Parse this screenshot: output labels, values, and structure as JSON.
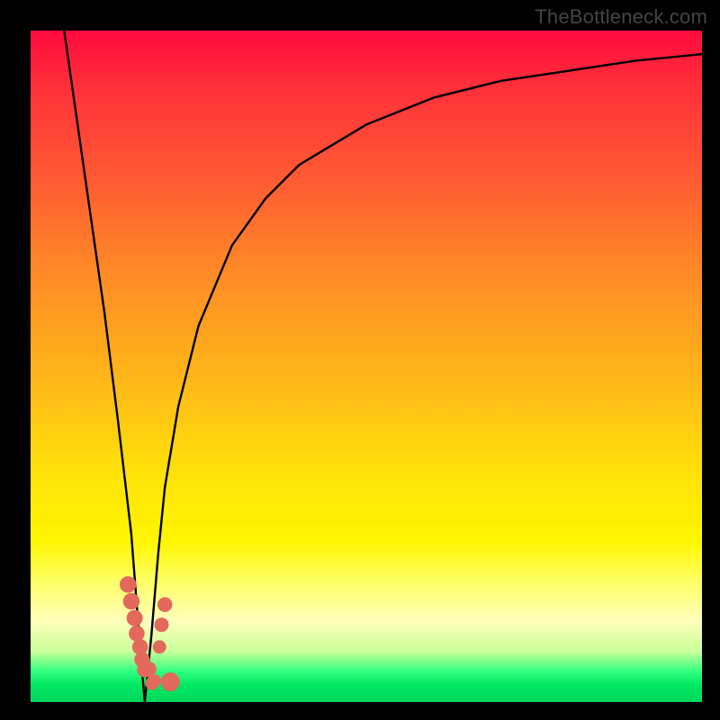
{
  "attribution": "TheBottleneck.com",
  "colors": {
    "frame": "#000000",
    "curve_stroke": "#000000",
    "marker_fill": "#e2695c",
    "gradient_stops": [
      "#ff0a3e",
      "#ff2f3a",
      "#ff5a33",
      "#ff8a26",
      "#ffb719",
      "#ffe20a",
      "#fff600",
      "#ffff66",
      "#ffffbb",
      "#c8ff9a",
      "#2fff7e",
      "#00e763",
      "#00d85a"
    ]
  },
  "chart_data": {
    "type": "line",
    "title": "",
    "xlabel": "",
    "ylabel": "",
    "xlim": [
      0,
      100
    ],
    "ylim": [
      0,
      100
    ],
    "x_at_min": 17,
    "series": [
      {
        "name": "bottleneck-curve",
        "x": [
          5,
          7,
          9,
          11,
          13,
          15,
          16,
          17,
          18,
          19,
          20,
          22,
          25,
          30,
          35,
          40,
          50,
          60,
          70,
          80,
          90,
          100
        ],
        "values": [
          100,
          86,
          72,
          58,
          42,
          25,
          12,
          0,
          10,
          22,
          32,
          44,
          56,
          68,
          75,
          80,
          86,
          90,
          92.5,
          94,
          95.5,
          96.5
        ]
      }
    ],
    "markers": {
      "name": "bottleneck-points",
      "x": [
        14.5,
        15,
        15.5,
        15.8,
        16.3,
        16.6,
        17,
        17.6,
        18.1,
        18.5,
        19.2,
        19.5,
        20,
        20.8
      ],
      "values": [
        17.5,
        15,
        12.5,
        10.2,
        8.2,
        6.3,
        4.8,
        4.9,
        2.8,
        3.2,
        8.2,
        11.5,
        14.5,
        3.0
      ],
      "radius": [
        9.2,
        9.2,
        9.0,
        8.8,
        8.8,
        8.6,
        8.6,
        8.4,
        7.6,
        6.8,
        7.4,
        8.0,
        8.2,
        10.5
      ]
    }
  }
}
